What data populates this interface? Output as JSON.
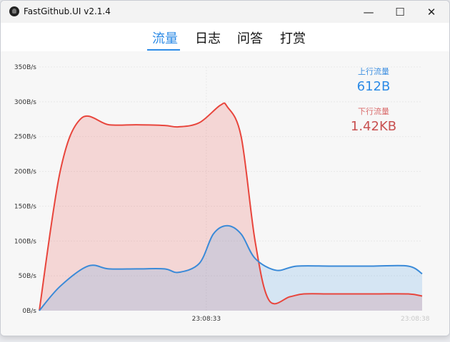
{
  "window": {
    "title": "FastGithub.UI v2.1.4",
    "controls": {
      "minimize": "—",
      "maximize": "☐",
      "close": "✕"
    }
  },
  "tabs": [
    {
      "label": "流量",
      "active": true
    },
    {
      "label": "日志",
      "active": false
    },
    {
      "label": "问答",
      "active": false
    },
    {
      "label": "打赏",
      "active": false
    }
  ],
  "legend": {
    "upload_label": "上行流量",
    "upload_value": "612B",
    "download_label": "下行流量",
    "download_value": "1.42KB",
    "upload_color": "#3b8ee0",
    "download_color": "#d95c5c"
  },
  "chart_data": {
    "type": "area",
    "y_ticks": [
      "0B/s",
      "50B/s",
      "100B/s",
      "150B/s",
      "200B/s",
      "250B/s",
      "300B/s",
      "350B/s"
    ],
    "ylim": [
      0,
      350
    ],
    "x_ticks": [
      {
        "label": "23:08:33",
        "t": 24
      },
      {
        "label": "23:08:38",
        "t": 54
      }
    ],
    "x_range": [
      0,
      55
    ],
    "grid": true,
    "series": [
      {
        "key": "download",
        "color": "#e8453c",
        "fill": "rgba(232,69,60,0.18)",
        "points": [
          [
            0,
            0
          ],
          [
            3,
            200
          ],
          [
            6,
            276
          ],
          [
            10,
            267
          ],
          [
            14,
            267
          ],
          [
            18,
            266
          ],
          [
            20,
            264
          ],
          [
            23,
            270
          ],
          [
            26,
            295
          ],
          [
            27,
            293
          ],
          [
            29,
            250
          ],
          [
            31,
            100
          ],
          [
            33,
            15
          ],
          [
            36,
            20
          ],
          [
            38,
            24
          ],
          [
            42,
            24
          ],
          [
            48,
            24
          ],
          [
            53,
            24
          ],
          [
            55,
            21
          ]
        ]
      },
      {
        "key": "upload",
        "color": "#3a8ad8",
        "fill": "rgba(80,160,230,0.20)",
        "points": [
          [
            0,
            0
          ],
          [
            3,
            35
          ],
          [
            7,
            64
          ],
          [
            10,
            60
          ],
          [
            14,
            60
          ],
          [
            18,
            60
          ],
          [
            20,
            55
          ],
          [
            23,
            68
          ],
          [
            25,
            110
          ],
          [
            27,
            122
          ],
          [
            29,
            110
          ],
          [
            31,
            75
          ],
          [
            34,
            58
          ],
          [
            37,
            64
          ],
          [
            42,
            64
          ],
          [
            48,
            64
          ],
          [
            53,
            64
          ],
          [
            55,
            53
          ]
        ]
      }
    ]
  }
}
